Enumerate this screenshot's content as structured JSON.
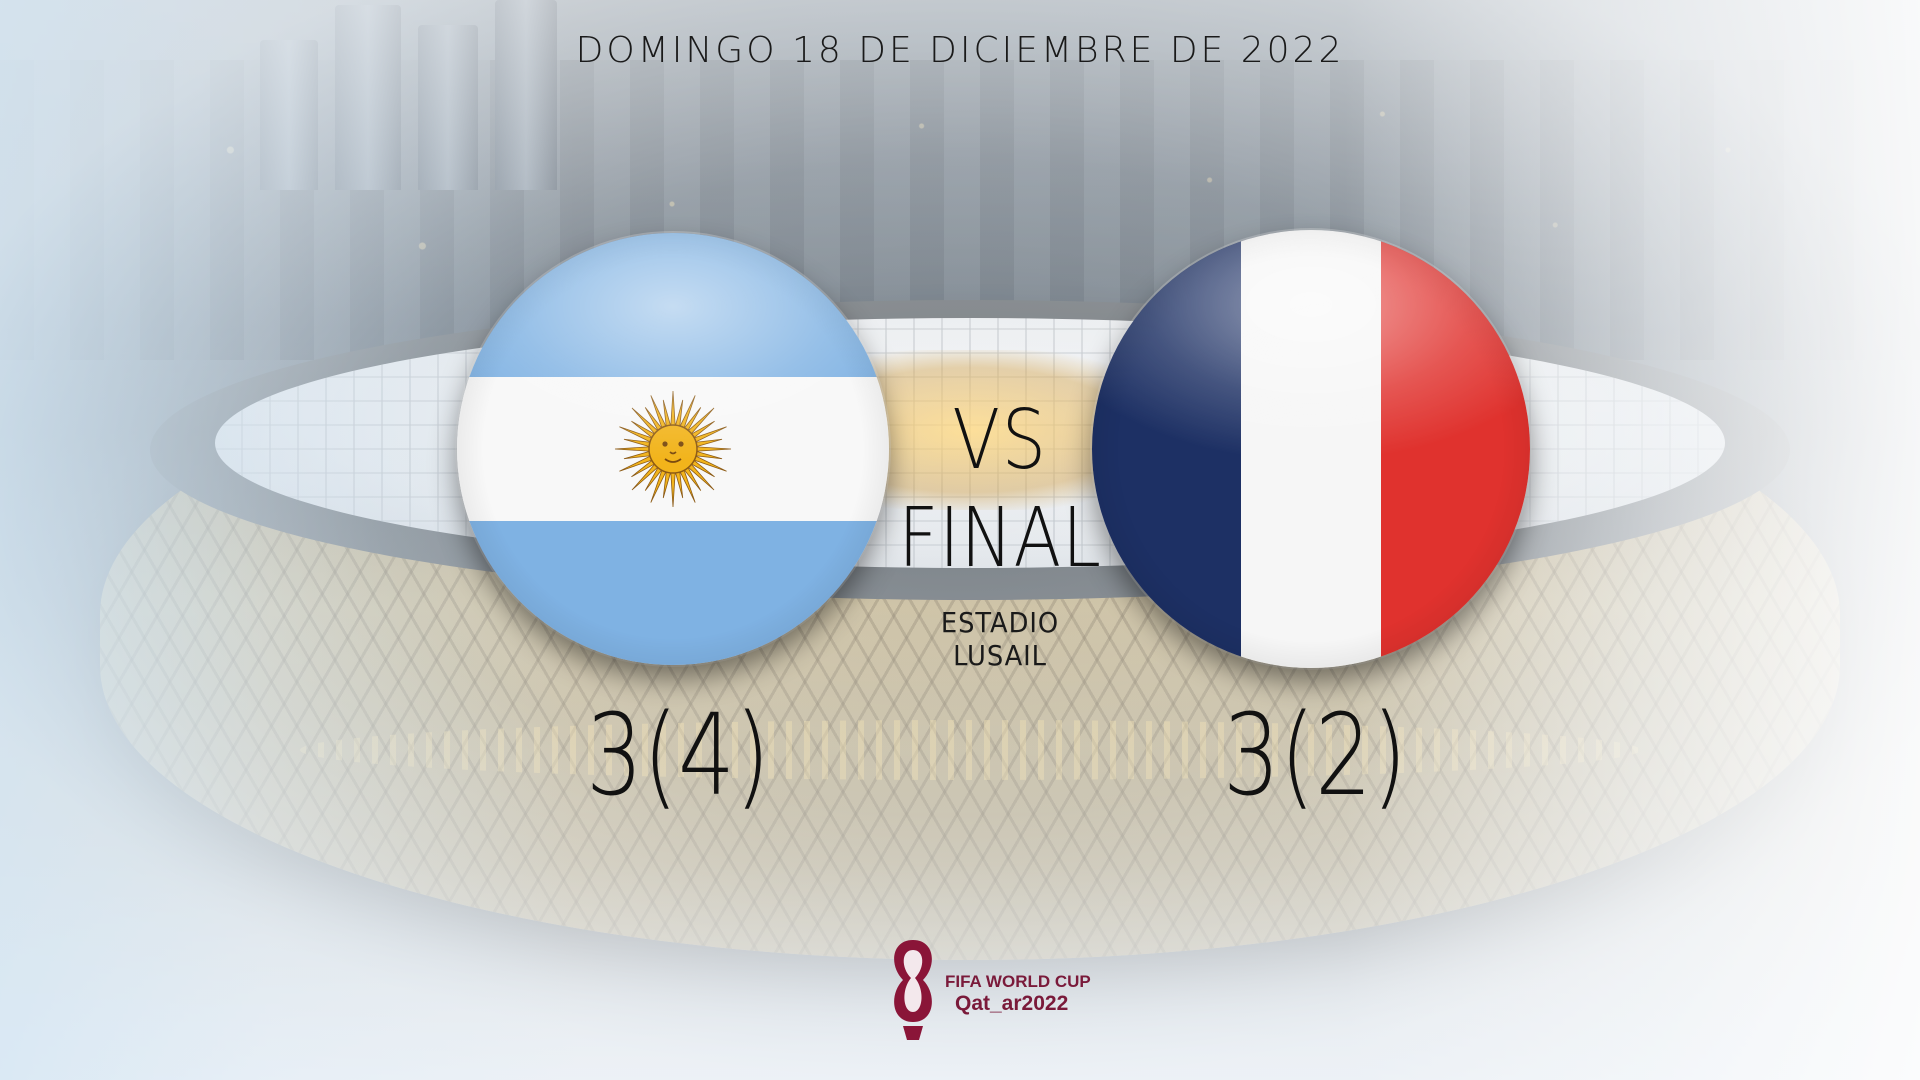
{
  "header": {
    "date": "DOMINGO 18 DE DICIEMBRE DE 2022"
  },
  "match": {
    "vs_label": "VS",
    "stage": "FINAL",
    "venue": "ESTADIO LUSAIL",
    "home": {
      "score": "3(4)",
      "flag_icon": "argentina-flag-icon",
      "colors": [
        "#7fb2e3",
        "#f8f8f8",
        "#f2b41b"
      ]
    },
    "away": {
      "score": "3(2)",
      "flag_icon": "france-flag-icon",
      "colors": [
        "#1d3064",
        "#f6f6f6",
        "#e0322e"
      ]
    }
  },
  "logo": {
    "line1": "FIFA WORLD CUP",
    "line2": "Qat_ar2022",
    "accent": "#7a1a3a"
  }
}
